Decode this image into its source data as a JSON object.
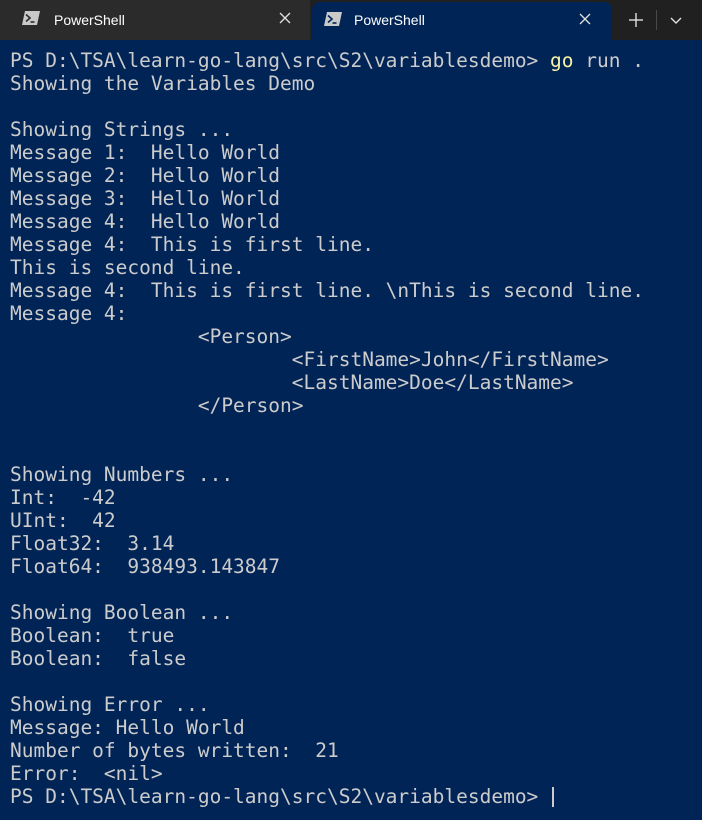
{
  "tabs": [
    {
      "label": "PowerShell",
      "active": false
    },
    {
      "label": "PowerShell",
      "active": true
    }
  ],
  "tabbar": {
    "new_tab_symbol": "+",
    "dropdown_symbol": "chevron-down"
  },
  "colors": {
    "terminal_background": "#012456",
    "terminal_text": "#cccccc",
    "command_highlight": "#f9f1a5",
    "tabbar_background": "#202020"
  },
  "terminal": {
    "prompt": "PS D:\\TSA\\learn-go-lang\\src\\S2\\variablesdemo> ",
    "command_name": "go",
    "command_args": " run .",
    "lines": [
      "Showing the Variables Demo",
      "",
      "Showing Strings ...",
      "Message 1:  Hello World",
      "Message 2:  Hello World",
      "Message 3:  Hello World",
      "Message 4:  Hello World",
      "Message 4:  This is first line.",
      "This is second line.",
      "Message 4:  This is first line. \\nThis is second line.",
      "Message 4:",
      "                <Person>",
      "                        <FirstName>John</FirstName>",
      "                        <LastName>Doe</LastName>",
      "                </Person>",
      "",
      "",
      "Showing Numbers ...",
      "Int:  -42",
      "UInt:  42",
      "Float32:  3.14",
      "Float64:  938493.143847",
      "",
      "Showing Boolean ...",
      "Boolean:  true",
      "Boolean:  false",
      "",
      "Showing Error ...",
      "Message: Hello World",
      "Number of bytes written:  21",
      "Error:  <nil>"
    ],
    "final_prompt": "PS D:\\TSA\\learn-go-lang\\src\\S2\\variablesdemo> "
  }
}
